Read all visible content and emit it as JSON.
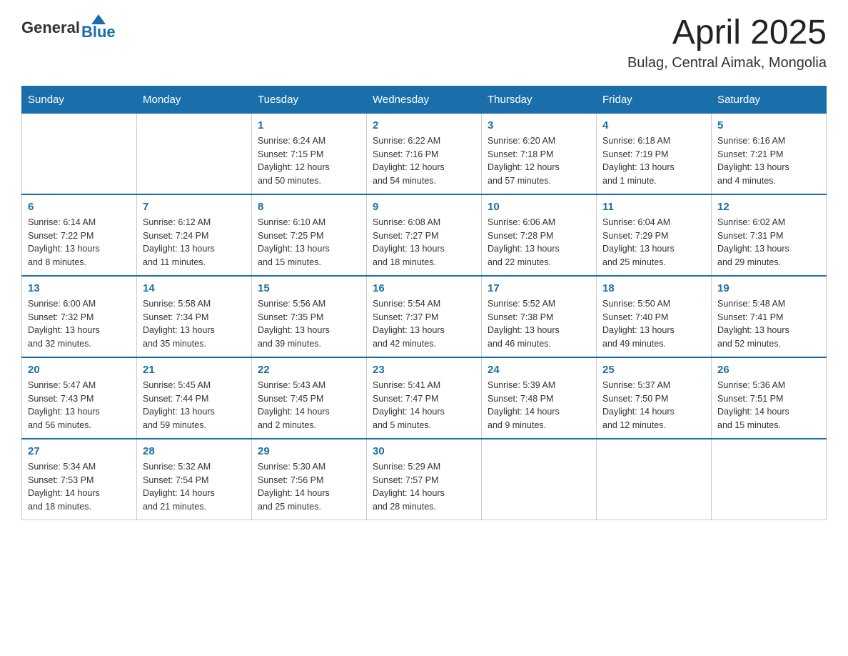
{
  "header": {
    "logo_general": "General",
    "logo_blue": "Blue",
    "month_title": "April 2025",
    "location": "Bulag, Central Aimak, Mongolia"
  },
  "days_of_week": [
    "Sunday",
    "Monday",
    "Tuesday",
    "Wednesday",
    "Thursday",
    "Friday",
    "Saturday"
  ],
  "weeks": [
    [
      {
        "day": "",
        "info": ""
      },
      {
        "day": "",
        "info": ""
      },
      {
        "day": "1",
        "info": "Sunrise: 6:24 AM\nSunset: 7:15 PM\nDaylight: 12 hours\nand 50 minutes."
      },
      {
        "day": "2",
        "info": "Sunrise: 6:22 AM\nSunset: 7:16 PM\nDaylight: 12 hours\nand 54 minutes."
      },
      {
        "day": "3",
        "info": "Sunrise: 6:20 AM\nSunset: 7:18 PM\nDaylight: 12 hours\nand 57 minutes."
      },
      {
        "day": "4",
        "info": "Sunrise: 6:18 AM\nSunset: 7:19 PM\nDaylight: 13 hours\nand 1 minute."
      },
      {
        "day": "5",
        "info": "Sunrise: 6:16 AM\nSunset: 7:21 PM\nDaylight: 13 hours\nand 4 minutes."
      }
    ],
    [
      {
        "day": "6",
        "info": "Sunrise: 6:14 AM\nSunset: 7:22 PM\nDaylight: 13 hours\nand 8 minutes."
      },
      {
        "day": "7",
        "info": "Sunrise: 6:12 AM\nSunset: 7:24 PM\nDaylight: 13 hours\nand 11 minutes."
      },
      {
        "day": "8",
        "info": "Sunrise: 6:10 AM\nSunset: 7:25 PM\nDaylight: 13 hours\nand 15 minutes."
      },
      {
        "day": "9",
        "info": "Sunrise: 6:08 AM\nSunset: 7:27 PM\nDaylight: 13 hours\nand 18 minutes."
      },
      {
        "day": "10",
        "info": "Sunrise: 6:06 AM\nSunset: 7:28 PM\nDaylight: 13 hours\nand 22 minutes."
      },
      {
        "day": "11",
        "info": "Sunrise: 6:04 AM\nSunset: 7:29 PM\nDaylight: 13 hours\nand 25 minutes."
      },
      {
        "day": "12",
        "info": "Sunrise: 6:02 AM\nSunset: 7:31 PM\nDaylight: 13 hours\nand 29 minutes."
      }
    ],
    [
      {
        "day": "13",
        "info": "Sunrise: 6:00 AM\nSunset: 7:32 PM\nDaylight: 13 hours\nand 32 minutes."
      },
      {
        "day": "14",
        "info": "Sunrise: 5:58 AM\nSunset: 7:34 PM\nDaylight: 13 hours\nand 35 minutes."
      },
      {
        "day": "15",
        "info": "Sunrise: 5:56 AM\nSunset: 7:35 PM\nDaylight: 13 hours\nand 39 minutes."
      },
      {
        "day": "16",
        "info": "Sunrise: 5:54 AM\nSunset: 7:37 PM\nDaylight: 13 hours\nand 42 minutes."
      },
      {
        "day": "17",
        "info": "Sunrise: 5:52 AM\nSunset: 7:38 PM\nDaylight: 13 hours\nand 46 minutes."
      },
      {
        "day": "18",
        "info": "Sunrise: 5:50 AM\nSunset: 7:40 PM\nDaylight: 13 hours\nand 49 minutes."
      },
      {
        "day": "19",
        "info": "Sunrise: 5:48 AM\nSunset: 7:41 PM\nDaylight: 13 hours\nand 52 minutes."
      }
    ],
    [
      {
        "day": "20",
        "info": "Sunrise: 5:47 AM\nSunset: 7:43 PM\nDaylight: 13 hours\nand 56 minutes."
      },
      {
        "day": "21",
        "info": "Sunrise: 5:45 AM\nSunset: 7:44 PM\nDaylight: 13 hours\nand 59 minutes."
      },
      {
        "day": "22",
        "info": "Sunrise: 5:43 AM\nSunset: 7:45 PM\nDaylight: 14 hours\nand 2 minutes."
      },
      {
        "day": "23",
        "info": "Sunrise: 5:41 AM\nSunset: 7:47 PM\nDaylight: 14 hours\nand 5 minutes."
      },
      {
        "day": "24",
        "info": "Sunrise: 5:39 AM\nSunset: 7:48 PM\nDaylight: 14 hours\nand 9 minutes."
      },
      {
        "day": "25",
        "info": "Sunrise: 5:37 AM\nSunset: 7:50 PM\nDaylight: 14 hours\nand 12 minutes."
      },
      {
        "day": "26",
        "info": "Sunrise: 5:36 AM\nSunset: 7:51 PM\nDaylight: 14 hours\nand 15 minutes."
      }
    ],
    [
      {
        "day": "27",
        "info": "Sunrise: 5:34 AM\nSunset: 7:53 PM\nDaylight: 14 hours\nand 18 minutes."
      },
      {
        "day": "28",
        "info": "Sunrise: 5:32 AM\nSunset: 7:54 PM\nDaylight: 14 hours\nand 21 minutes."
      },
      {
        "day": "29",
        "info": "Sunrise: 5:30 AM\nSunset: 7:56 PM\nDaylight: 14 hours\nand 25 minutes."
      },
      {
        "day": "30",
        "info": "Sunrise: 5:29 AM\nSunset: 7:57 PM\nDaylight: 14 hours\nand 28 minutes."
      },
      {
        "day": "",
        "info": ""
      },
      {
        "day": "",
        "info": ""
      },
      {
        "day": "",
        "info": ""
      }
    ]
  ]
}
